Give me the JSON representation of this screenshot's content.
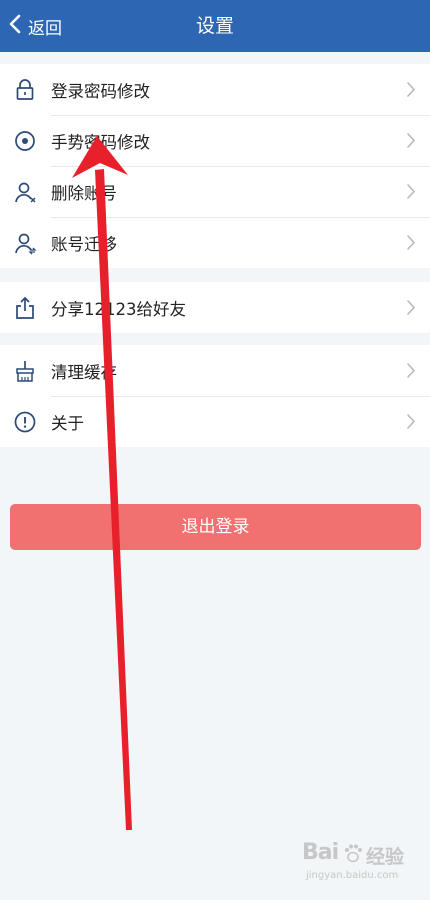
{
  "navbar": {
    "back_label": "返回",
    "title": "设置",
    "color": "#2d67b3"
  },
  "groups": [
    {
      "items": [
        {
          "label": "登录密码修改",
          "icon": "lock-icon"
        },
        {
          "label": "手势密码修改",
          "icon": "gesture-icon"
        },
        {
          "label": "删除账号",
          "icon": "delete-user-icon"
        },
        {
          "label": "账号迁移",
          "icon": "migrate-user-icon"
        }
      ]
    },
    {
      "items": [
        {
          "label": "分享12123给好友",
          "icon": "share-icon"
        }
      ]
    },
    {
      "items": [
        {
          "label": "清理缓存",
          "icon": "broom-icon"
        },
        {
          "label": "关于",
          "icon": "info-icon"
        }
      ]
    }
  ],
  "logout": {
    "label": "退出登录",
    "color": "#f07170"
  },
  "annotation": {
    "type": "red-arrow",
    "color": "#e8202b"
  },
  "watermark": {
    "logo": "Bai",
    "brand": "经验",
    "url": "jingyan.baidu.com"
  }
}
